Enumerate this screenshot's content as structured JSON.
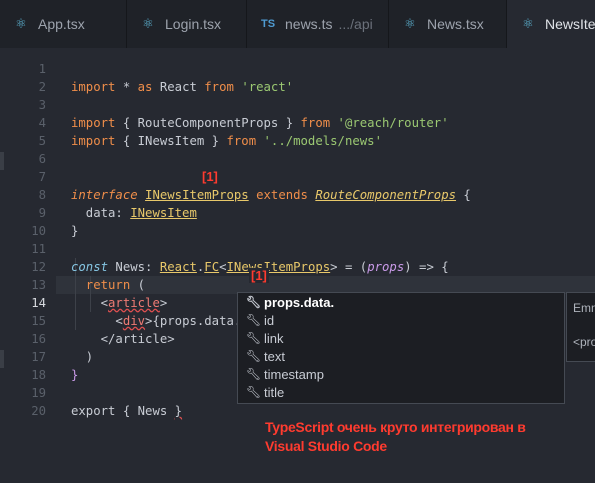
{
  "tabs": [
    {
      "icon": "react-icon",
      "label": "App.tsx",
      "path": ""
    },
    {
      "icon": "react-icon",
      "label": "Login.tsx",
      "path": ""
    },
    {
      "icon": "ts-icon",
      "label": "news.ts",
      "path": ".../api"
    },
    {
      "icon": "react-icon",
      "label": "News.tsx",
      "path": ""
    },
    {
      "icon": "react-icon",
      "label": "NewsItem",
      "path": ""
    }
  ],
  "ts_icon_text": "TS",
  "editor": {
    "line_numbers": [
      "1",
      "2",
      "3",
      "4",
      "5",
      "6",
      "7",
      "8",
      "9",
      "10",
      "11",
      "12",
      "13",
      "14",
      "15",
      "16",
      "17",
      "18",
      "19",
      "20"
    ],
    "current_line": "14",
    "code": {
      "l1": {
        "a": "import",
        "b": " * ",
        "c": "as",
        "d": " React ",
        "e": "from",
        "f": " ",
        "g": "'react'"
      },
      "l3": {
        "a": "import",
        "b": " { RouteComponentProps } ",
        "c": "from",
        "d": " ",
        "e": "'@reach/router'"
      },
      "l4": {
        "a": "import",
        "b": " { INewsItem } ",
        "c": "from",
        "d": " ",
        "e": "'../models/news'"
      },
      "l7": {
        "a": "interface",
        "b": " ",
        "c": "INewsItemProps",
        "d": " ",
        "e": "extends",
        "f": " ",
        "g": "RouteComponentProps",
        "h": " {"
      },
      "l8": {
        "a": "  data: ",
        "b": "INewsItem"
      },
      "l9": {
        "a": "}"
      },
      "l11": {
        "a": "const",
        "b": " News: ",
        "c": "React",
        "d": ".",
        "e": "FC",
        "f": "<",
        "g": "INewsItemProps",
        "h": "> = (",
        "i": "props",
        "j": ") => {"
      },
      "l12": {
        "a": "  return",
        "b": " ("
      },
      "l13": {
        "a": "    <",
        "b": "article",
        "c": ">"
      },
      "l14": {
        "a": "      <",
        "b": "div",
        "c": ">{props.data."
      },
      "l15": {
        "a": "    </",
        "b": "article",
        "c": ">"
      },
      "l16": {
        "a": "  )"
      },
      "l17": {
        "a": "}"
      },
      "l19": {
        "a": "export",
        "b": " { News ",
        "c": "}"
      }
    }
  },
  "markers": {
    "m1": "[1]",
    "m2": "[1]"
  },
  "suggestions": [
    {
      "label": "props.data.",
      "selected": true
    },
    {
      "label": "id",
      "selected": false
    },
    {
      "label": "link",
      "selected": false
    },
    {
      "label": "text",
      "selected": false
    },
    {
      "label": "timestamp",
      "selected": false
    },
    {
      "label": "title",
      "selected": false
    }
  ],
  "detail": {
    "line1": "Emm",
    "line2": "<pro"
  },
  "caption": {
    "line1": "TypeScript очень круто интегрирован в",
    "line2": "Visual Studio Code"
  }
}
